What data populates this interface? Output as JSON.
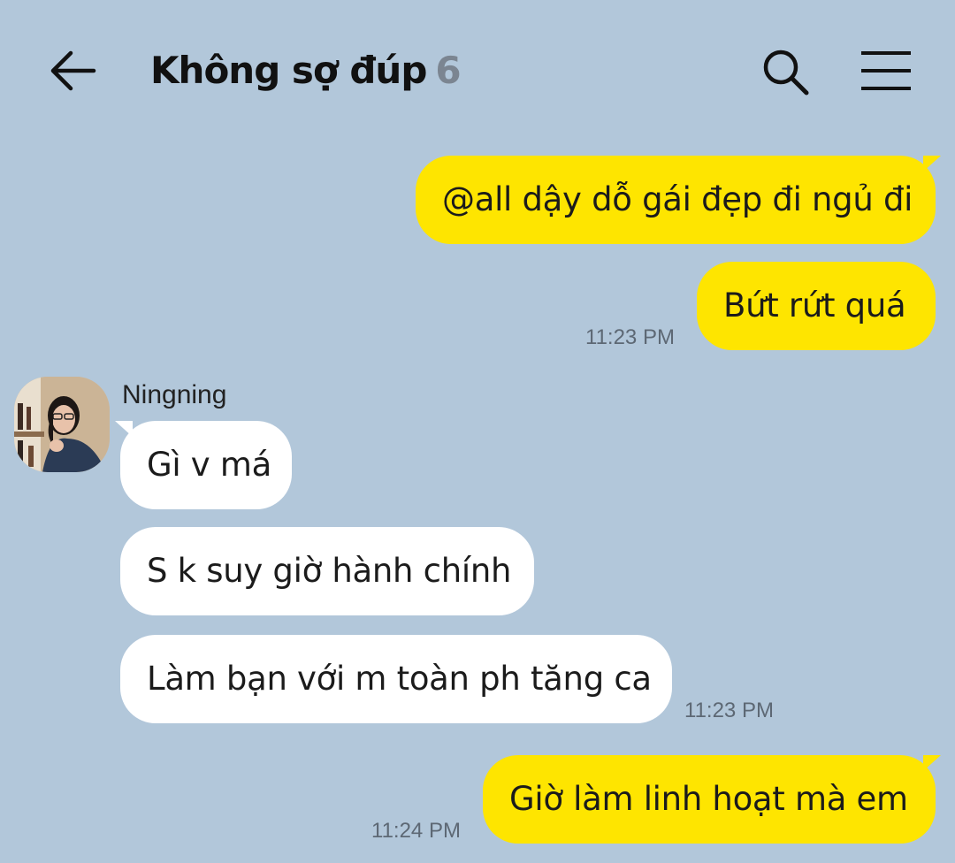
{
  "chat": {
    "title": "Không sợ đúp",
    "member_count": "6"
  },
  "messages": [
    {
      "sender": "me",
      "text": "@all dậy dỗ gái đẹp đi ngủ đi"
    },
    {
      "sender": "me",
      "text": "Bứt rứt quá",
      "time": "11:23 PM"
    },
    {
      "sender": "Ningning",
      "text": "Gì v má"
    },
    {
      "sender": "Ningning",
      "text": "S k suy giờ hành chính"
    },
    {
      "sender": "Ningning",
      "text": "Làm bạn với m toàn ph tăng ca",
      "time": "11:23 PM"
    },
    {
      "sender": "me",
      "text": "Giờ làm linh hoạt mà em",
      "time": "11:24 PM"
    }
  ],
  "icons": {
    "back": "arrow-left-icon",
    "search": "search-icon",
    "menu": "hamburger-menu-icon",
    "avatar": "user-avatar-photo"
  },
  "colors": {
    "background": "#b2c7da",
    "my_bubble": "#fee500",
    "their_bubble": "#ffffff",
    "member_count": "#7b8591",
    "time": "#5d6874"
  }
}
